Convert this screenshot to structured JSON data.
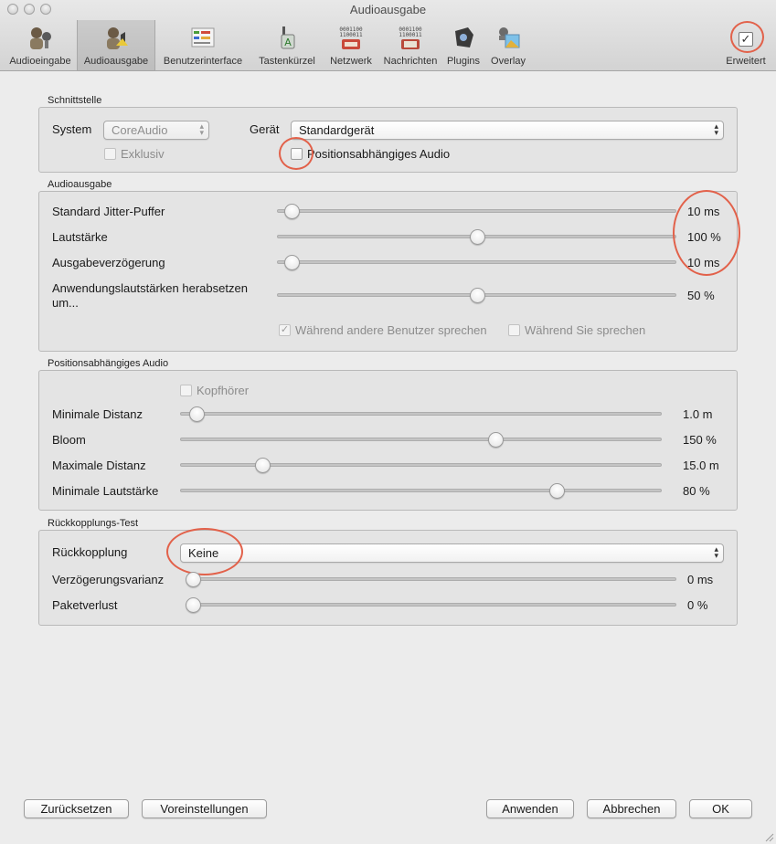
{
  "window": {
    "title": "Audioausgabe"
  },
  "toolbar": {
    "items": [
      {
        "label": "Audioeingabe",
        "icon": "microphone-user-icon",
        "active": false
      },
      {
        "label": "Audioausgabe",
        "icon": "speaker-user-icon",
        "active": true
      },
      {
        "label": "Benutzerinterface",
        "icon": "interface-icon",
        "active": false
      },
      {
        "label": "Tastenkürzel",
        "icon": "keyboard-shortcut-icon",
        "active": false
      },
      {
        "label": "Netzwerk",
        "icon": "network-icon",
        "active": false
      },
      {
        "label": "Nachrichten",
        "icon": "messages-icon",
        "active": false
      },
      {
        "label": "Plugins",
        "icon": "plugins-icon",
        "active": false
      },
      {
        "label": "Overlay",
        "icon": "overlay-icon",
        "active": false
      }
    ],
    "advanced": {
      "label": "Erweitert",
      "checked": true
    }
  },
  "interface": {
    "title": "Schnittstelle",
    "system_label": "System",
    "system_value": "CoreAudio",
    "device_label": "Gerät",
    "device_value": "Standardgerät",
    "exclusive_label": "Exklusiv",
    "positional_label": "Positionsabhängiges Audio"
  },
  "output": {
    "title": "Audioausgabe",
    "rows": [
      {
        "label": "Standard Jitter-Puffer",
        "value": "10 ms",
        "fraction": 0.02
      },
      {
        "label": "Lautstärke",
        "value": "100 %",
        "fraction": 0.5
      },
      {
        "label": "Ausgabeverzögerung",
        "value": "10 ms",
        "fraction": 0.02
      },
      {
        "label": "Anwendungslautstärken herabsetzen um...",
        "value": "50 %",
        "fraction": 0.5
      }
    ],
    "attenuate_others_label": "Während andere Benutzer sprechen",
    "attenuate_self_label": "Während Sie sprechen"
  },
  "positional": {
    "title": "Positionsabhängiges Audio",
    "headphones_label": "Kopfhörer",
    "rows": [
      {
        "label": "Minimale Distanz",
        "value": "1.0 m",
        "fraction": 0.02
      },
      {
        "label": "Bloom",
        "value": "150 %",
        "fraction": 0.66
      },
      {
        "label": "Maximale Distanz",
        "value": "15.0 m",
        "fraction": 0.16
      },
      {
        "label": "Minimale Lautstärke",
        "value": "80 %",
        "fraction": 0.79
      }
    ]
  },
  "loopback": {
    "title": "Rückkopplungs-Test",
    "mode_label": "Rückkopplung",
    "mode_value": "Keine",
    "rows": [
      {
        "label": "Verzögerungsvarianz",
        "value": "0 ms",
        "fraction": 0.0
      },
      {
        "label": "Paketverlust",
        "value": "0 %",
        "fraction": 0.0
      }
    ]
  },
  "buttons": {
    "reset": "Zurücksetzen",
    "defaults": "Voreinstellungen",
    "apply": "Anwenden",
    "cancel": "Abbrechen",
    "ok": "OK"
  },
  "colors": {
    "highlight_ring": "#e2614a"
  }
}
